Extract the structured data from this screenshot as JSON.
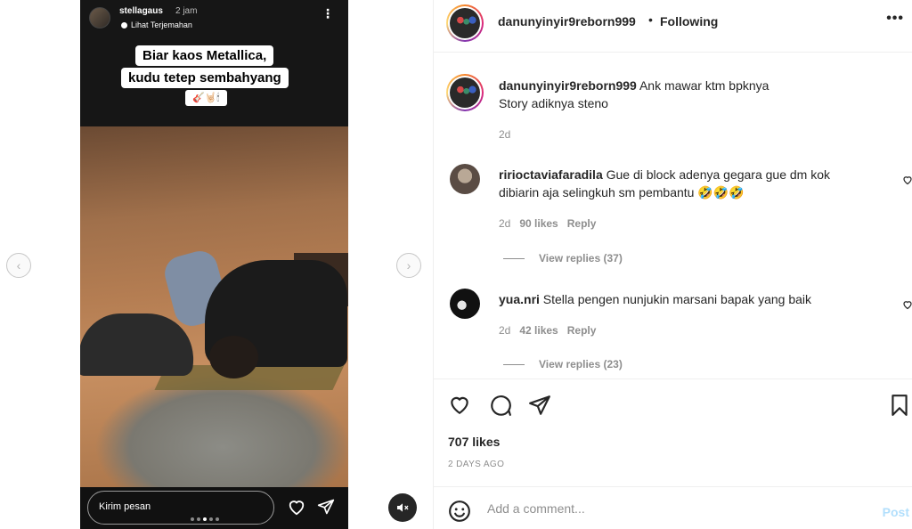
{
  "story": {
    "username": "stellagaus",
    "time": "2 jam",
    "translate_label": "Lihat Terjemahan",
    "caption_line1": "Biar kaos Metallica,",
    "caption_line2": "kudu tetep sembahyang",
    "caption_emoji": "🎸🤘🏻🕯",
    "message_placeholder": "Kirim pesan",
    "more_icon": "⋮"
  },
  "nav": {
    "prev_icon": "‹",
    "next_icon": "›"
  },
  "header": {
    "username": "danunyinyir9reborn999",
    "separator": "•",
    "follow_status": "Following",
    "more_icon": "•••"
  },
  "caption": {
    "username": "danunyinyir9reborn999",
    "line1": "Ank mawar ktm bpknya",
    "line2": "Story adiknya steno",
    "age": "2d"
  },
  "comments": [
    {
      "username": "ririoctaviafaradila",
      "text_line1": "Gue di block adenya gegara gue dm kok",
      "text_line2": "dibiarin aja selingkuh sm pembantu 🤣🤣🤣",
      "age": "2d",
      "likes": "90 likes",
      "reply": "Reply",
      "view_replies": "View replies (37)"
    },
    {
      "username": "yua.nri",
      "text_line1": "Stella pengen nunjukin marsani bapak yang baik",
      "age": "2d",
      "likes": "42 likes",
      "reply": "Reply",
      "view_replies": "View replies (23)"
    }
  ],
  "post": {
    "likes": "707 likes",
    "date": "2 DAYS AGO"
  },
  "add_comment": {
    "placeholder": "Add a comment...",
    "post_label": "Post"
  },
  "colors": {
    "text": "#262626",
    "secondary": "#8e8e8e",
    "border": "#efefef",
    "post_disabled": "#b2dffc"
  }
}
